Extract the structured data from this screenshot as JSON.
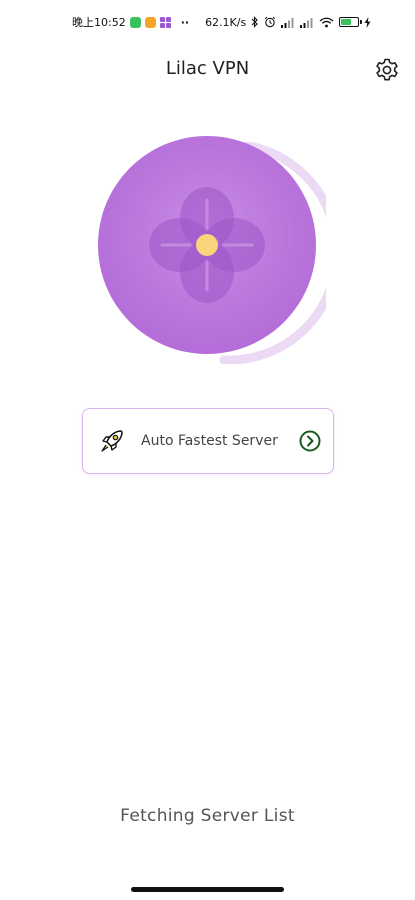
{
  "status_bar": {
    "time": "晚上10:52",
    "net_speed": "62.1K/s",
    "battery_level": 0.62
  },
  "header": {
    "title": "Lilac VPN"
  },
  "server": {
    "label": "Auto Fastest Server"
  },
  "footer": {
    "status": "Fetching Server List"
  },
  "colors": {
    "accent": "#b56dd8",
    "accent_dark": "#9d55c6",
    "center_dot": "#f7d57a",
    "chevron": "#1b5a1e"
  },
  "icons": {
    "settings": "gear-icon",
    "server": "rocket-icon",
    "go": "chevron-right-circle-icon"
  }
}
